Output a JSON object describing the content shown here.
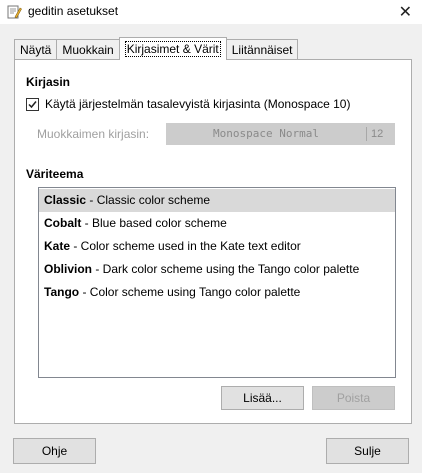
{
  "window": {
    "title": "geditin asetukset",
    "icon": "text-editor-icon",
    "close_icon": "close-icon"
  },
  "tabs": [
    {
      "label": "Näytä",
      "active": false
    },
    {
      "label": "Muokkain",
      "active": false
    },
    {
      "label": "Kirjasimet & Värit",
      "active": true
    },
    {
      "label": "Liitännäiset",
      "active": false
    }
  ],
  "font_section": {
    "title": "Kirjasin",
    "system_font_checkbox": {
      "label": "Käytä järjestelmän tasalevyistä kirjasinta (Monospace 10)",
      "checked": true
    },
    "editor_font_label": "Muokkaimen kirjasin:",
    "editor_font_name": "Monospace Normal",
    "editor_font_size": "12"
  },
  "scheme_section": {
    "title": "Väriteema",
    "items": [
      {
        "name": "Classic",
        "desc": " - Classic color scheme",
        "selected": true
      },
      {
        "name": "Cobalt",
        "desc": " - Blue based color scheme",
        "selected": false
      },
      {
        "name": "Kate",
        "desc": " - Color scheme used in the Kate text editor",
        "selected": false
      },
      {
        "name": "Oblivion",
        "desc": " - Dark color scheme using the Tango color palette",
        "selected": false
      },
      {
        "name": "Tango",
        "desc": " - Color scheme using Tango color palette",
        "selected": false
      }
    ],
    "add_button": "Lisää...",
    "remove_button": "Poista"
  },
  "footer": {
    "help_button": "Ohje",
    "close_button": "Sulje"
  },
  "colors": {
    "window_bg": "#f0f0f0",
    "panel_bg": "#ffffff",
    "selected_row": "#d9d9d9",
    "disabled_text": "#a0a0a0"
  }
}
